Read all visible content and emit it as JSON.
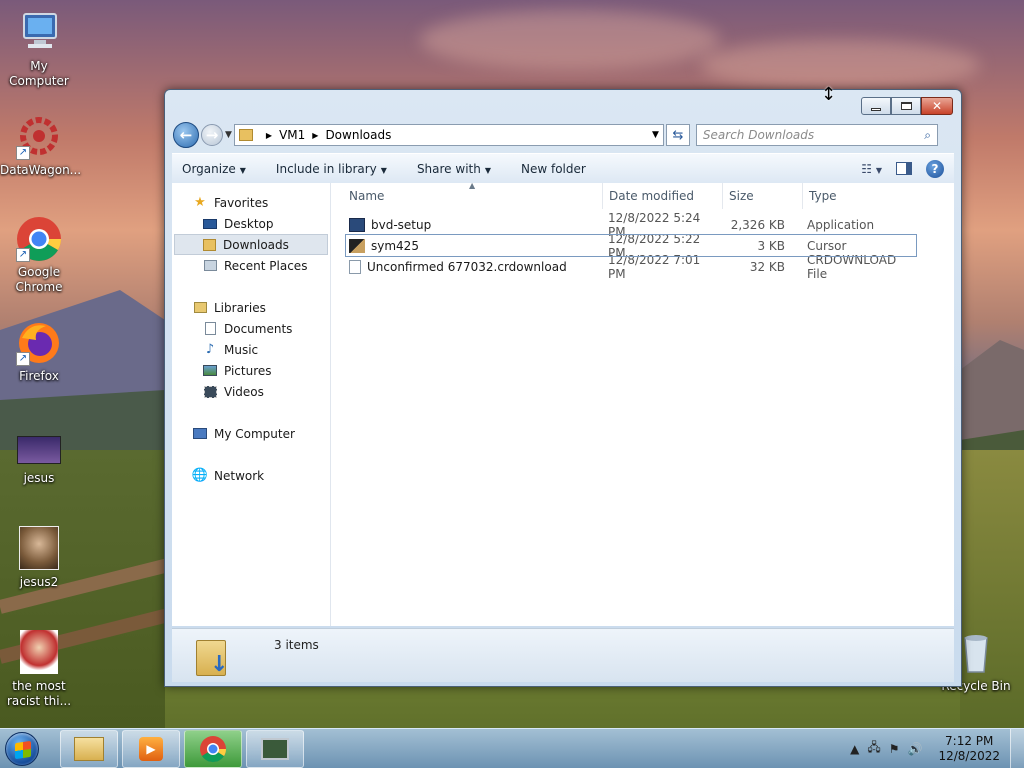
{
  "desktop": {
    "icons": [
      {
        "label": "My Computer"
      },
      {
        "label": "DataWagon..."
      },
      {
        "label": "Google Chrome"
      },
      {
        "label": "Firefox"
      },
      {
        "label": "jesus"
      },
      {
        "label": "jesus2"
      },
      {
        "label": "the most racist thi..."
      },
      {
        "label": "Recycle Bin"
      }
    ]
  },
  "window": {
    "address": {
      "root": "VM1",
      "folder": "Downloads"
    },
    "search_placeholder": "Search Downloads",
    "toolbar": {
      "organize": "Organize",
      "include": "Include in library",
      "share": "Share with",
      "newfolder": "New folder"
    },
    "nav": {
      "favorites": "Favorites",
      "desktop": "Desktop",
      "downloads": "Downloads",
      "recent": "Recent Places",
      "libraries": "Libraries",
      "documents": "Documents",
      "music": "Music",
      "pictures": "Pictures",
      "videos": "Videos",
      "mycomputer": "My Computer",
      "network": "Network"
    },
    "columns": {
      "name": "Name",
      "date": "Date modified",
      "size": "Size",
      "type": "Type"
    },
    "files": [
      {
        "name": "bvd-setup",
        "date": "12/8/2022 5:24 PM",
        "size": "2,326 KB",
        "type": "Application"
      },
      {
        "name": "sym425",
        "date": "12/8/2022 5:22 PM",
        "size": "3 KB",
        "type": "Cursor"
      },
      {
        "name": "Unconfirmed 677032.crdownload",
        "date": "12/8/2022 7:01 PM",
        "size": "32 KB",
        "type": "CRDOWNLOAD File"
      }
    ],
    "status": "3 items"
  },
  "taskbar": {
    "time": "7:12 PM",
    "date": "12/8/2022"
  },
  "colors": {
    "accent": "#2d6cb0",
    "close": "#c8432a"
  }
}
